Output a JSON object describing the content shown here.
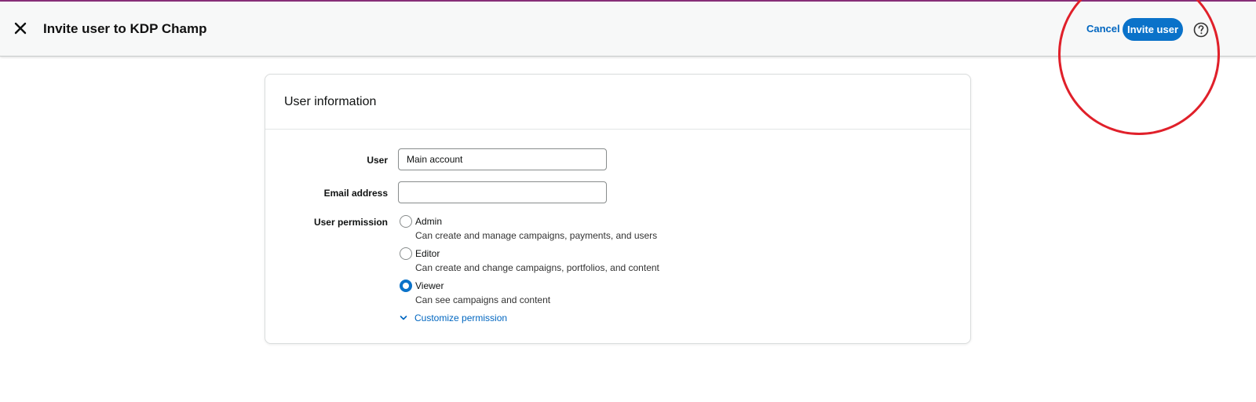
{
  "header": {
    "title": "Invite user to KDP Champ",
    "cancel_label": "Cancel",
    "invite_label": "Invite user",
    "close_icon": "close-icon",
    "help_icon": "help-icon"
  },
  "card": {
    "title": "User information",
    "user": {
      "label": "User",
      "value": "Main account"
    },
    "email": {
      "label": "Email address",
      "value": "",
      "placeholder": ""
    },
    "permission": {
      "label": "User permission",
      "selected": "Viewer",
      "options": [
        {
          "label": "Admin",
          "description": "Can create and manage campaigns, payments, and users",
          "checked": false
        },
        {
          "label": "Editor",
          "description": "Can create and change campaigns, portfolios, and content",
          "checked": false
        },
        {
          "label": "Viewer",
          "description": "Can see campaigns and content",
          "checked": true
        }
      ],
      "customize_label": "Customize permission"
    }
  },
  "colors": {
    "accent": "#0a72c9",
    "link": "#0066c0",
    "annotation": "#e0202a",
    "top_line": "#8a2f7a"
  }
}
